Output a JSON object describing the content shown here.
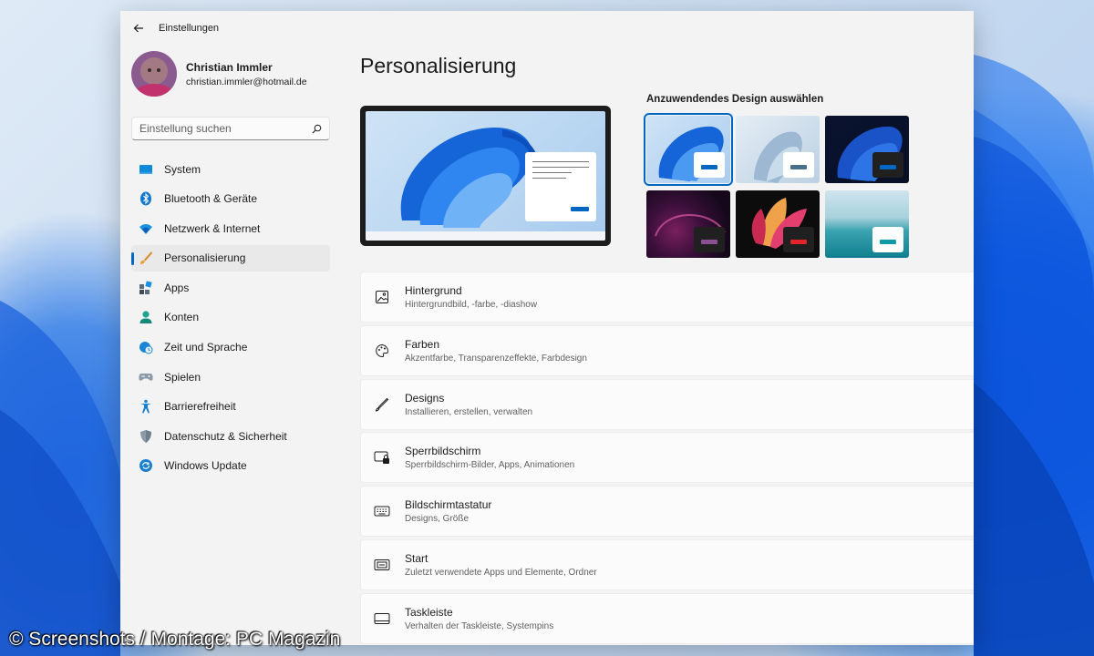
{
  "window": {
    "title": "Einstellungen"
  },
  "profile": {
    "name": "Christian Immler",
    "email": "christian.immler@hotmail.de"
  },
  "search": {
    "placeholder": "Einstellung suchen"
  },
  "nav": {
    "items": [
      {
        "label": "System",
        "icon": "monitor-icon"
      },
      {
        "label": "Bluetooth & Geräte",
        "icon": "bluetooth-icon"
      },
      {
        "label": "Netzwerk & Internet",
        "icon": "wifi-icon"
      },
      {
        "label": "Personalisierung",
        "icon": "brush-icon",
        "active": true
      },
      {
        "label": "Apps",
        "icon": "apps-icon"
      },
      {
        "label": "Konten",
        "icon": "person-icon"
      },
      {
        "label": "Zeit und Sprache",
        "icon": "globe-clock-icon"
      },
      {
        "label": "Spielen",
        "icon": "gamepad-icon"
      },
      {
        "label": "Barrierefreiheit",
        "icon": "accessibility-icon"
      },
      {
        "label": "Datenschutz & Sicherheit",
        "icon": "shield-icon"
      },
      {
        "label": "Windows Update",
        "icon": "update-icon"
      }
    ]
  },
  "main": {
    "page_title": "Personalisierung",
    "themes_heading": "Anzuwendendes Design auswählen",
    "themes": [
      {
        "name": "windows-light",
        "chip_bg": "#ffffff",
        "chip_bar": "#0067c0",
        "selected": true
      },
      {
        "name": "glow",
        "chip_bg": "#ffffff",
        "chip_bar": "#4a6f8a"
      },
      {
        "name": "windows-dark",
        "chip_bg": "#202020",
        "chip_bar": "#0067c0"
      },
      {
        "name": "captured-motion",
        "chip_bg": "#202020",
        "chip_bar": "#8b4e92"
      },
      {
        "name": "flow",
        "chip_bg": "#202020",
        "chip_bar": "#e0242a"
      },
      {
        "name": "sunrise",
        "chip_bg": "#ffffff",
        "chip_bar": "#0f9aa8"
      }
    ],
    "settings": [
      {
        "title": "Hintergrund",
        "desc": "Hintergrundbild, -farbe, -diashow",
        "icon": "image-icon"
      },
      {
        "title": "Farben",
        "desc": "Akzentfarbe, Transparenzeffekte, Farbdesign",
        "icon": "palette-icon"
      },
      {
        "title": "Designs",
        "desc": "Installieren, erstellen, verwalten",
        "icon": "pen-icon"
      },
      {
        "title": "Sperrbildschirm",
        "desc": "Sperrbildschirm-Bilder, Apps, Animationen",
        "icon": "lock-screen-icon"
      },
      {
        "title": "Bildschirmtastatur",
        "desc": "Designs, Größe",
        "icon": "keyboard-icon"
      },
      {
        "title": "Start",
        "desc": "Zuletzt verwendete Apps und Elemente, Ordner",
        "icon": "start-icon"
      },
      {
        "title": "Taskleiste",
        "desc": "Verhalten der Taskleiste, Systempins",
        "icon": "taskbar-icon"
      }
    ]
  },
  "watermark": "© Screenshots / Montage: PC Magazin",
  "colors": {
    "accent": "#0067c0",
    "window_bg": "#f3f3f3",
    "card_bg": "#fbfbfb"
  }
}
